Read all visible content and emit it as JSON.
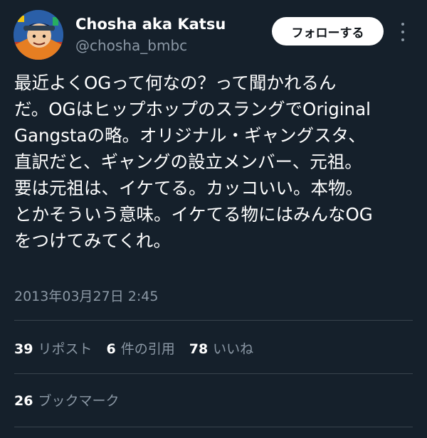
{
  "author": {
    "display_name": "Chosha aka Katsu",
    "handle": "@chosha_bmbc",
    "avatar_icon": "user-avatar-icon"
  },
  "header": {
    "follow_label": "フォローする",
    "more_icon": "more-vertical-icon"
  },
  "tweet": {
    "lines": [
      "最近よくOGって何なの？って聞かれるん",
      "だ。OGはヒップホップのスラングでOriginal",
      "Gangstaの略。オリジナル・ギャングスタ、",
      "直訳だと、ギャングの設立メンバー、元祖。",
      "要は元祖は、イケてる。カッコいい。本物。",
      "とかそういう意味。イケてる物にはみんなOG",
      "をつけてみてくれ。"
    ],
    "timestamp": "2013年03月27日 2:45"
  },
  "stats": {
    "reposts": {
      "count": "39",
      "label": "リポスト"
    },
    "quotes": {
      "count": "6",
      "label": "件の引用"
    },
    "likes": {
      "count": "78",
      "label": "いいね"
    },
    "bookmarks": {
      "count": "26",
      "label": "ブックマーク"
    }
  },
  "colors": {
    "background": "#15202b",
    "text": "#ffffff",
    "secondary_text": "#8b98a5",
    "divider": "#38444d",
    "follow_button_bg": "#ffffff"
  }
}
